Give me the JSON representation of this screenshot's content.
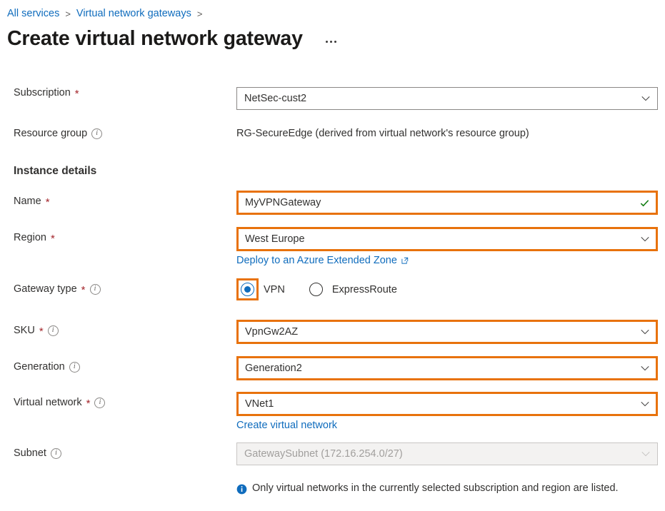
{
  "breadcrumb": {
    "items": [
      "All services",
      "Virtual network gateways"
    ],
    "separator": ">"
  },
  "header": {
    "title": "Create virtual network gateway",
    "more_menu": "..."
  },
  "form": {
    "subscription": {
      "label": "Subscription",
      "required": "*",
      "value": "NetSec-cust2",
      "icon": "chevron-down-icon"
    },
    "resource_group": {
      "label": "Resource group",
      "info_icon": "info-icon",
      "value": "RG-SecureEdge (derived from virtual network's resource group)"
    },
    "section_title": "Instance details",
    "name": {
      "label": "Name",
      "required": "*",
      "value": "MyVPNGateway",
      "validation_icon": "checkmark-icon",
      "highlight_color": "#e8720c"
    },
    "region": {
      "label": "Region",
      "required": "*",
      "value": "West Europe",
      "icon": "chevron-down-icon",
      "sublink": "Deploy to an Azure Extended Zone",
      "sublink_icon": "external-link-icon",
      "highlight_color": "#e8720c"
    },
    "gateway_type": {
      "label": "Gateway type",
      "required": "*",
      "info_icon": "info-icon",
      "options": [
        {
          "label": "VPN",
          "selected": true,
          "highlighted": true
        },
        {
          "label": "ExpressRoute",
          "selected": false,
          "highlighted": false
        }
      ]
    },
    "sku": {
      "label": "SKU",
      "required": "*",
      "info_icon": "info-icon",
      "value": "VpnGw2AZ",
      "icon": "chevron-down-icon",
      "highlight_color": "#e8720c"
    },
    "generation": {
      "label": "Generation",
      "info_icon": "info-icon",
      "value": "Generation2",
      "icon": "chevron-down-icon",
      "highlight_color": "#e8720c"
    },
    "virtual_network": {
      "label": "Virtual network",
      "required": "*",
      "info_icon": "info-icon",
      "value": "VNet1",
      "icon": "chevron-down-icon",
      "sublink": "Create virtual network",
      "highlight_color": "#e8720c"
    },
    "subnet": {
      "label": "Subnet",
      "info_icon": "info-icon",
      "value": "GatewaySubnet (172.16.254.0/27)",
      "icon": "chevron-down-icon",
      "disabled": true
    },
    "info_banner": {
      "icon": "info-filled-icon",
      "text": "Only virtual networks in the currently selected subscription and region are listed."
    }
  },
  "colors": {
    "link": "#0f6cbd",
    "highlight": "#e8720c",
    "required": "#a4262c",
    "success": "#107c10"
  }
}
